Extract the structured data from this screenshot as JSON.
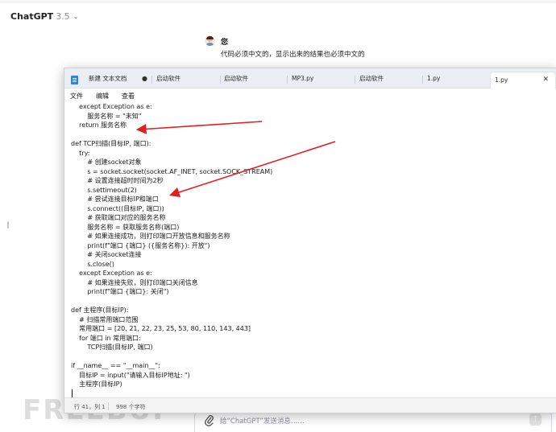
{
  "header": {
    "brand": "ChatGPT",
    "version": "3.5",
    "chevron": "⌄"
  },
  "message": {
    "sender": "您",
    "text": "代码必须中文的，显示出来的结果也必须中文的"
  },
  "notepad": {
    "tabs": [
      {
        "label": "新建 文本文档",
        "modified_dot": "●"
      },
      {
        "label": "启动软件"
      },
      {
        "label": "启动软件"
      },
      {
        "label": "MP3.py"
      },
      {
        "label": "启动软件"
      },
      {
        "label": "1.py"
      }
    ],
    "active_tab": {
      "label": "1.py",
      "close": "✕"
    },
    "menu": {
      "file": "文件",
      "edit": "编辑",
      "view": "查看"
    },
    "code_lines": [
      "    except Exception as e:",
      "        服务名称 = \"未知\"",
      "    return 服务名称",
      "",
      "def TCP扫描(目标IP, 端口):",
      "    try:",
      "        # 创建socket对象",
      "        s = socket.socket(socket.AF_INET, socket.SOCK_STREAM)",
      "        # 设置连接超时时间为2秒",
      "        s.settimeout(2)",
      "        # 尝试连接目标IP和端口",
      "        s.connect((目标IP, 端口))",
      "        # 获取端口对应的服务名称",
      "        服务名称 = 获取服务名称(端口)",
      "        # 如果连接成功，则打印端口开放信息和服务名称",
      "        print(f\"端口 {端口} ({服务名称}): 开放\")",
      "        # 关闭socket连接",
      "        s.close()",
      "    except Exception as e:",
      "        # 如果连接失败，则打印端口关闭信息",
      "        print(f\"端口 {端口}: 关闭\")",
      "",
      "def 主程序(目标IP):",
      "    # 扫描常用端口范围",
      "    常用端口 = [20, 21, 22, 23, 25, 53, 80, 110, 143, 443]",
      "    for 端口 in 常用端口:",
      "        TCP扫描(目标IP, 端口)",
      "",
      "if __name__ == \"__main__\":",
      "    目标IP = input(\"请输入目标IP地址: \")",
      "    主程序(目标IP)"
    ],
    "status": {
      "position": "行 41，列 1",
      "chars": "998 个字符"
    }
  },
  "composer": {
    "placeholder": "给“ChatGPT”发送消息……",
    "send_glyph": "↑"
  },
  "watermark": "FREEBUF",
  "colors": {
    "arrow": "#e0201e",
    "tabstrip": "#ebeff5",
    "app_icon": "#3b7ed4"
  }
}
